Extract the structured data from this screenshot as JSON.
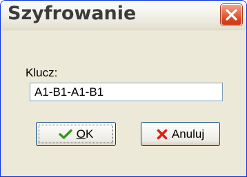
{
  "window": {
    "title": "Szyfrowanie",
    "close_icon": "close-icon"
  },
  "form": {
    "key_label": "Klucz:",
    "key_value": "A1-B1-A1-B1"
  },
  "buttons": {
    "ok_label": "OK",
    "ok_icon": "checkmark-icon",
    "cancel_label": "Anuluj",
    "cancel_icon": "red-x-icon"
  },
  "colors": {
    "accent_close": "#d8451f",
    "ok_check": "#2e9a1c",
    "cancel_x": "#e02010",
    "dialog_bg": "#ece9d8",
    "input_border": "#7f9db9"
  }
}
